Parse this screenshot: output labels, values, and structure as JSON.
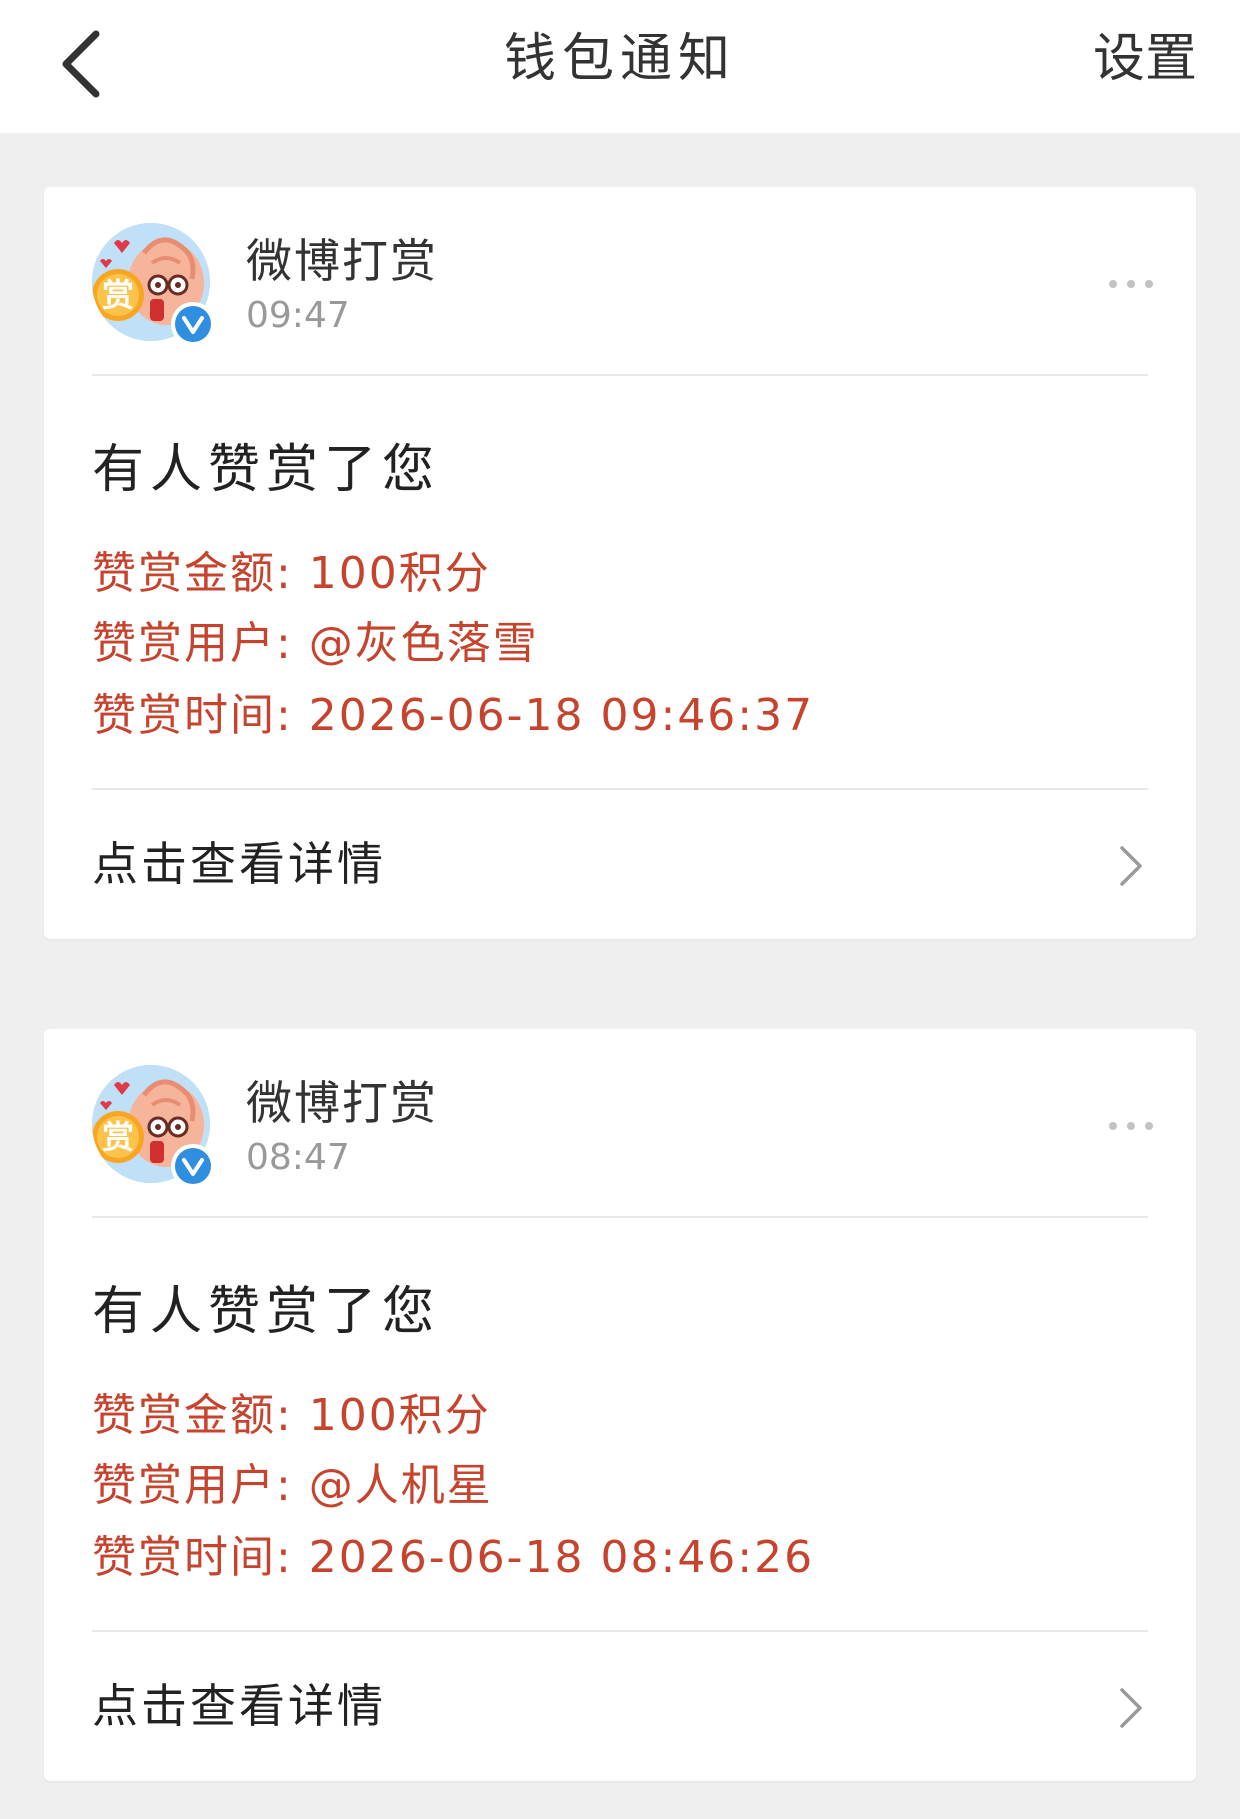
{
  "header": {
    "title": "钱包通知",
    "settings_label": "设置",
    "back_icon": "chevron-left-icon"
  },
  "colors": {
    "accent_red": "#c6432d",
    "verified_blue": "#2f8ee0",
    "background": "#efefef"
  },
  "notifications": [
    {
      "sender": "微博打赏",
      "time": "09:47",
      "avatar_badge": "赏",
      "title": "有人赞赏了您",
      "amount_line": "赞赏金额: 100积分",
      "user_line": "赞赏用户: @灰色落雪",
      "datetime_line": "赞赏时间: 2026-06-18 09:46:37",
      "action_label": "点击查看详情"
    },
    {
      "sender": "微博打赏",
      "time": "08:47",
      "avatar_badge": "赏",
      "title": "有人赞赏了您",
      "amount_line": "赞赏金额: 100积分",
      "user_line": "赞赏用户: @人机星",
      "datetime_line": "赞赏时间: 2026-06-18 08:46:26",
      "action_label": "点击查看详情"
    }
  ]
}
